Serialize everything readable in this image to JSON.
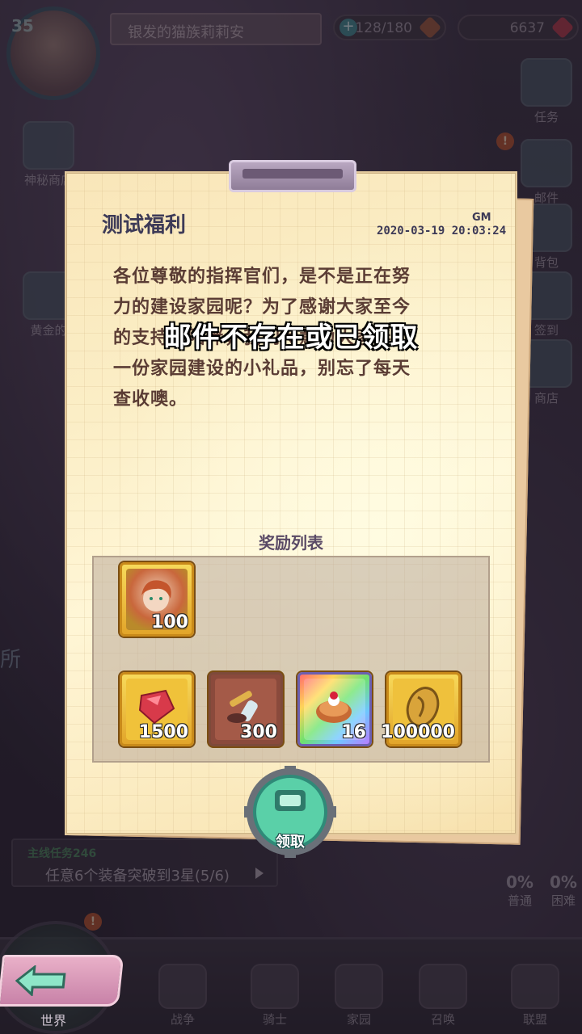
{
  "hud": {
    "level": "35",
    "player_name": "银发的猫族莉莉安",
    "stamina": "128/180",
    "gems": "6637",
    "side_left": [
      {
        "label": "神秘商店"
      },
      {
        "label": "黄金的"
      }
    ],
    "side_right": [
      {
        "label": "任务"
      },
      {
        "label": "邮件"
      },
      {
        "label": "背包"
      },
      {
        "label": "签到"
      },
      {
        "label": "商店"
      }
    ],
    "left_partial_text": "所"
  },
  "quest": {
    "title": "主线任务246",
    "text": "任意6个装备突破到3星(5/6)"
  },
  "progress": [
    {
      "value": "0%",
      "label": "普通"
    },
    {
      "value": "0%",
      "label": "困难"
    }
  ],
  "bottom_nav": {
    "world": "世界",
    "items": [
      "战争",
      "骑士",
      "家园",
      "召唤",
      "联盟"
    ]
  },
  "mail": {
    "title": "测试福利",
    "sender": "GM",
    "date": "2020-03-19 20:03:24",
    "body_lines": [
      "各位尊敬的指挥官们，是不是正在努",
      "力的建设家园呢？为了感谢大家至今",
      "的支持与陪伴，我们特意为大家奉上",
      "一份家园建设的小礼品，别忘了每天",
      "查收噢。"
    ],
    "toast": "邮件不存在或已领取",
    "rewards_title": "奖励列表",
    "rewards": [
      {
        "name": "hero-shard",
        "qty": "100"
      },
      {
        "name": "ruby",
        "qty": "1500"
      },
      {
        "name": "brush-tools",
        "qty": "300"
      },
      {
        "name": "cherry-pie",
        "qty": "16"
      },
      {
        "name": "gold-coin",
        "qty": "100000"
      }
    ],
    "claim_label": "领取"
  },
  "colors": {
    "paper": "#fbeec6",
    "title_text": "#3d3a57",
    "body_text": "#5a3c34",
    "claim_button": "#5ad0a8",
    "reward_frame": "#c98a1a"
  }
}
